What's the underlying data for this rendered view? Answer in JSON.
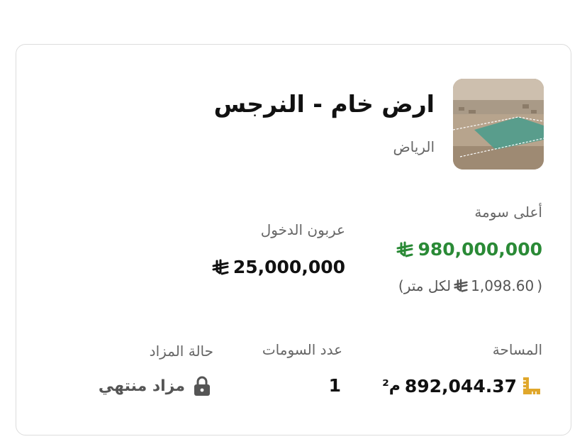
{
  "listing": {
    "title": "ارض خام - النرجس",
    "city": "الرياض",
    "thumbnail_icon": "land-aerial-photo"
  },
  "highest_bid": {
    "label": "أعلى سومة",
    "amount": "980,000,000",
    "per_meter_open": "(",
    "per_meter_amount": "1,098.60",
    "per_meter_suffix": "لكل متر)"
  },
  "deposit": {
    "label": "عربون الدخول",
    "amount": "25,000,000"
  },
  "area": {
    "label": "المساحة",
    "amount": "892,044.37",
    "unit": "م²"
  },
  "bids_count": {
    "label": "عدد السومات",
    "value": "1"
  },
  "auction_status": {
    "label": "حالة المزاد",
    "value": "مزاد منتهي"
  },
  "colors": {
    "accent_green": "#2a8a36",
    "ruler_gold": "#e0a72b",
    "text_muted": "#666666"
  },
  "icons": [
    "riyal-icon",
    "ruler-icon",
    "lock-icon"
  ]
}
